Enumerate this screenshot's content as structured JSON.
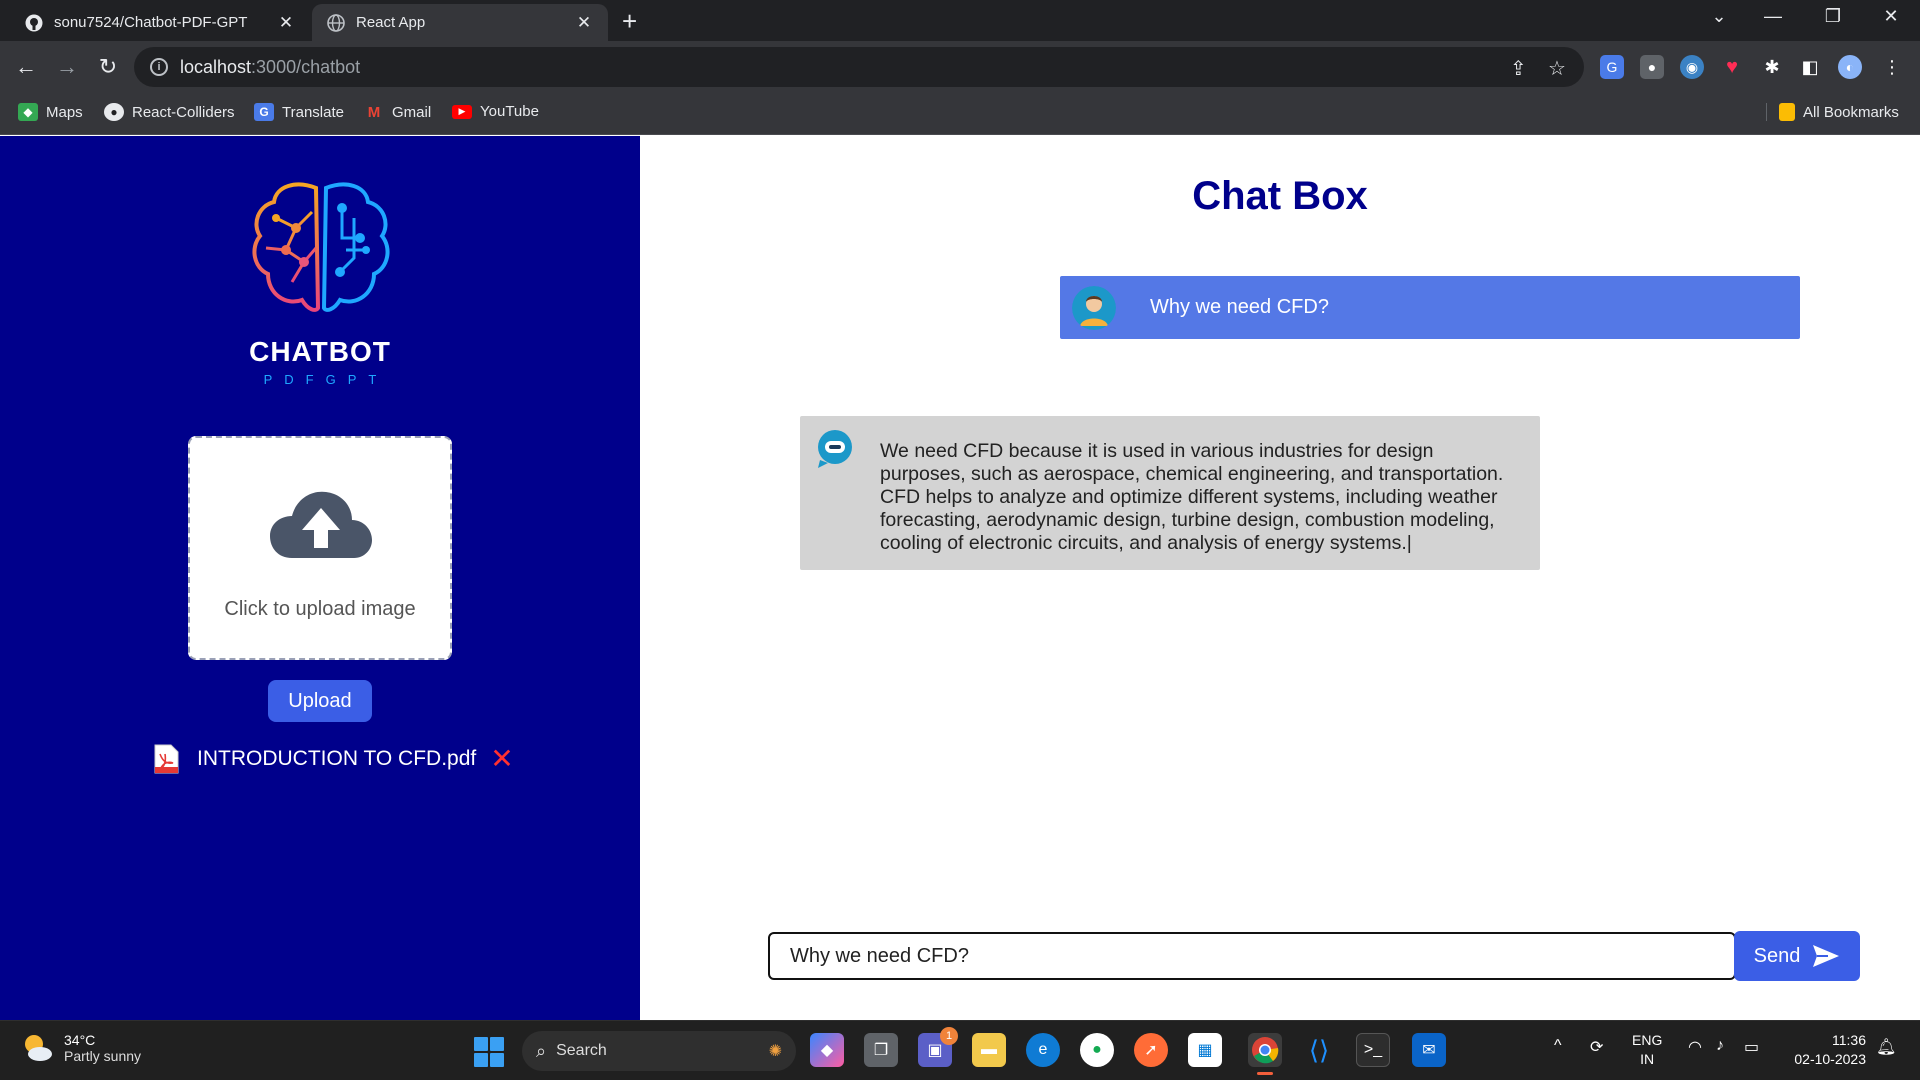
{
  "browser": {
    "tabs": [
      {
        "title": "sonu7524/Chatbot-PDF-GPT",
        "active": false
      },
      {
        "title": "React App",
        "active": true
      }
    ],
    "new_tab_label": "+",
    "url_host": "localhost",
    "url_path": ":3000/chatbot",
    "bookmarks": [
      "Maps",
      "React-Colliders",
      "Translate",
      "Gmail",
      "YouTube"
    ],
    "all_bookmarks": "All Bookmarks"
  },
  "sidebar": {
    "brand_title": "CHATBOT",
    "brand_subtitle": "PDFGPT",
    "upload_prompt": "Click to upload image",
    "upload_button": "Upload",
    "file_name": "INTRODUCTION TO CFD.pdf",
    "remove_label": "✕"
  },
  "chat": {
    "title": "Chat Box",
    "messages": [
      {
        "role": "user",
        "text": "Why we need CFD?"
      },
      {
        "role": "bot",
        "text": "We need CFD because it is used in various industries for design purposes, such as aerospace, chemical engineering, and transportation. CFD helps to analyze and optimize different systems, including weather forecasting, aerodynamic design, turbine design, combustion modeling, cooling of electronic circuits, and analysis of energy systems.|"
      }
    ],
    "input_value": "Why we need CFD?",
    "send_label": "Send"
  },
  "taskbar": {
    "weather_temp": "34°C",
    "weather_desc": "Partly sunny",
    "search_label": "Search",
    "chat_badge": "1",
    "lang_1": "ENG",
    "lang_2": "IN",
    "time": "11:36",
    "date": "02-10-2023"
  },
  "colors": {
    "sidebar_bg": "#00008b",
    "accent": "#3b5ee6",
    "user_bubble": "#5478e6",
    "bot_bubble": "#d3d3d3",
    "title": "#00008b"
  }
}
